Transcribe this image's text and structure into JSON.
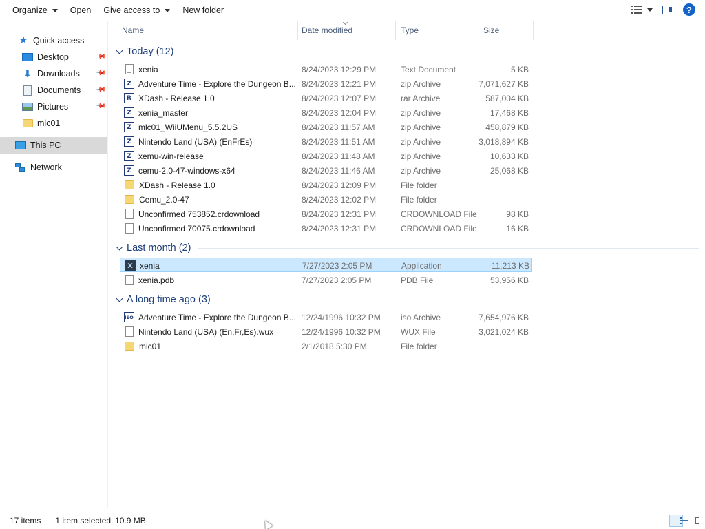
{
  "toolbar": {
    "items": [
      {
        "label": "Organize",
        "has_menu": true
      },
      {
        "label": "Open",
        "has_menu": false
      },
      {
        "label": "Give access to",
        "has_menu": true
      },
      {
        "label": "New folder",
        "has_menu": false
      }
    ],
    "view_icon": "details-view-icon",
    "pane_icon": "preview-pane-icon",
    "help_label": "?"
  },
  "nav": {
    "items": [
      {
        "label": "Quick access",
        "icon": "star-icon",
        "pinned": false
      },
      {
        "label": "Desktop",
        "icon": "desktop-icon",
        "pinned": true
      },
      {
        "label": "Downloads",
        "icon": "download-icon",
        "pinned": true
      },
      {
        "label": "Documents",
        "icon": "documents-icon",
        "pinned": true
      },
      {
        "label": "Pictures",
        "icon": "pictures-icon",
        "pinned": true
      },
      {
        "label": "mlc01",
        "icon": "folder-icon",
        "pinned": false
      },
      {
        "label": "This PC",
        "icon": "computer-icon",
        "selected": true
      },
      {
        "label": "Network",
        "icon": "network-icon"
      }
    ]
  },
  "columns": {
    "name": "Name",
    "date": "Date modified",
    "type": "Type",
    "size": "Size"
  },
  "groups": [
    {
      "title": "Today (12)",
      "rows": [
        {
          "name": "xenia",
          "date": "8/24/2023 12:29 PM",
          "type": "Text Document",
          "size": "5 KB",
          "icon": "text"
        },
        {
          "name": "Adventure Time - Explore the Dungeon B...",
          "date": "8/24/2023 12:21 PM",
          "type": "zip Archive",
          "size": "7,071,627 KB",
          "icon": "zip"
        },
        {
          "name": "XDash - Release 1.0",
          "date": "8/24/2023 12:07 PM",
          "type": "rar Archive",
          "size": "587,004 KB",
          "icon": "rar"
        },
        {
          "name": "xenia_master",
          "date": "8/24/2023 12:04 PM",
          "type": "zip Archive",
          "size": "17,468 KB",
          "icon": "zip"
        },
        {
          "name": "mlc01_WiiUMenu_5.5.2US",
          "date": "8/24/2023 11:57 AM",
          "type": "zip Archive",
          "size": "458,879 KB",
          "icon": "zip"
        },
        {
          "name": "Nintendo Land (USA) (EnFrEs)",
          "date": "8/24/2023 11:51 AM",
          "type": "zip Archive",
          "size": "3,018,894 KB",
          "icon": "zip"
        },
        {
          "name": "xemu-win-release",
          "date": "8/24/2023 11:48 AM",
          "type": "zip Archive",
          "size": "10,633 KB",
          "icon": "zip"
        },
        {
          "name": "cemu-2.0-47-windows-x64",
          "date": "8/24/2023 11:46 AM",
          "type": "zip Archive",
          "size": "25,068 KB",
          "icon": "zip"
        },
        {
          "name": "XDash - Release 1.0",
          "date": "8/24/2023 12:09 PM",
          "type": "File folder",
          "size": "",
          "icon": "folder"
        },
        {
          "name": "Cemu_2.0-47",
          "date": "8/24/2023 12:02 PM",
          "type": "File folder",
          "size": "",
          "icon": "folder"
        },
        {
          "name": "Unconfirmed 753852.crdownload",
          "date": "8/24/2023 12:31 PM",
          "type": "CRDOWNLOAD File",
          "size": "98 KB",
          "icon": "blank"
        },
        {
          "name": "Unconfirmed 70075.crdownload",
          "date": "8/24/2023 12:31 PM",
          "type": "CRDOWNLOAD File",
          "size": "16 KB",
          "icon": "blank"
        }
      ]
    },
    {
      "title": "Last month (2)",
      "rows": [
        {
          "name": "xenia",
          "date": "7/27/2023 2:05 PM",
          "type": "Application",
          "size": "11,213 KB",
          "icon": "app",
          "selected": true
        },
        {
          "name": "xenia.pdb",
          "date": "7/27/2023 2:05 PM",
          "type": "PDB File",
          "size": "53,956 KB",
          "icon": "blank"
        }
      ]
    },
    {
      "title": "A long time ago (3)",
      "rows": [
        {
          "name": "Adventure Time - Explore the Dungeon B...",
          "date": "12/24/1996 10:32 PM",
          "type": "iso Archive",
          "size": "7,654,976 KB",
          "icon": "iso"
        },
        {
          "name": "Nintendo Land (USA) (En,Fr,Es).wux",
          "date": "12/24/1996 10:32 PM",
          "type": "WUX File",
          "size": "3,021,024 KB",
          "icon": "blank"
        },
        {
          "name": "mlc01",
          "date": "2/1/2018 5:30 PM",
          "type": "File folder",
          "size": "",
          "icon": "folder"
        }
      ]
    }
  ],
  "status": {
    "count": "17 items",
    "selection": "1 item selected",
    "selection_size": "10.9 MB"
  }
}
